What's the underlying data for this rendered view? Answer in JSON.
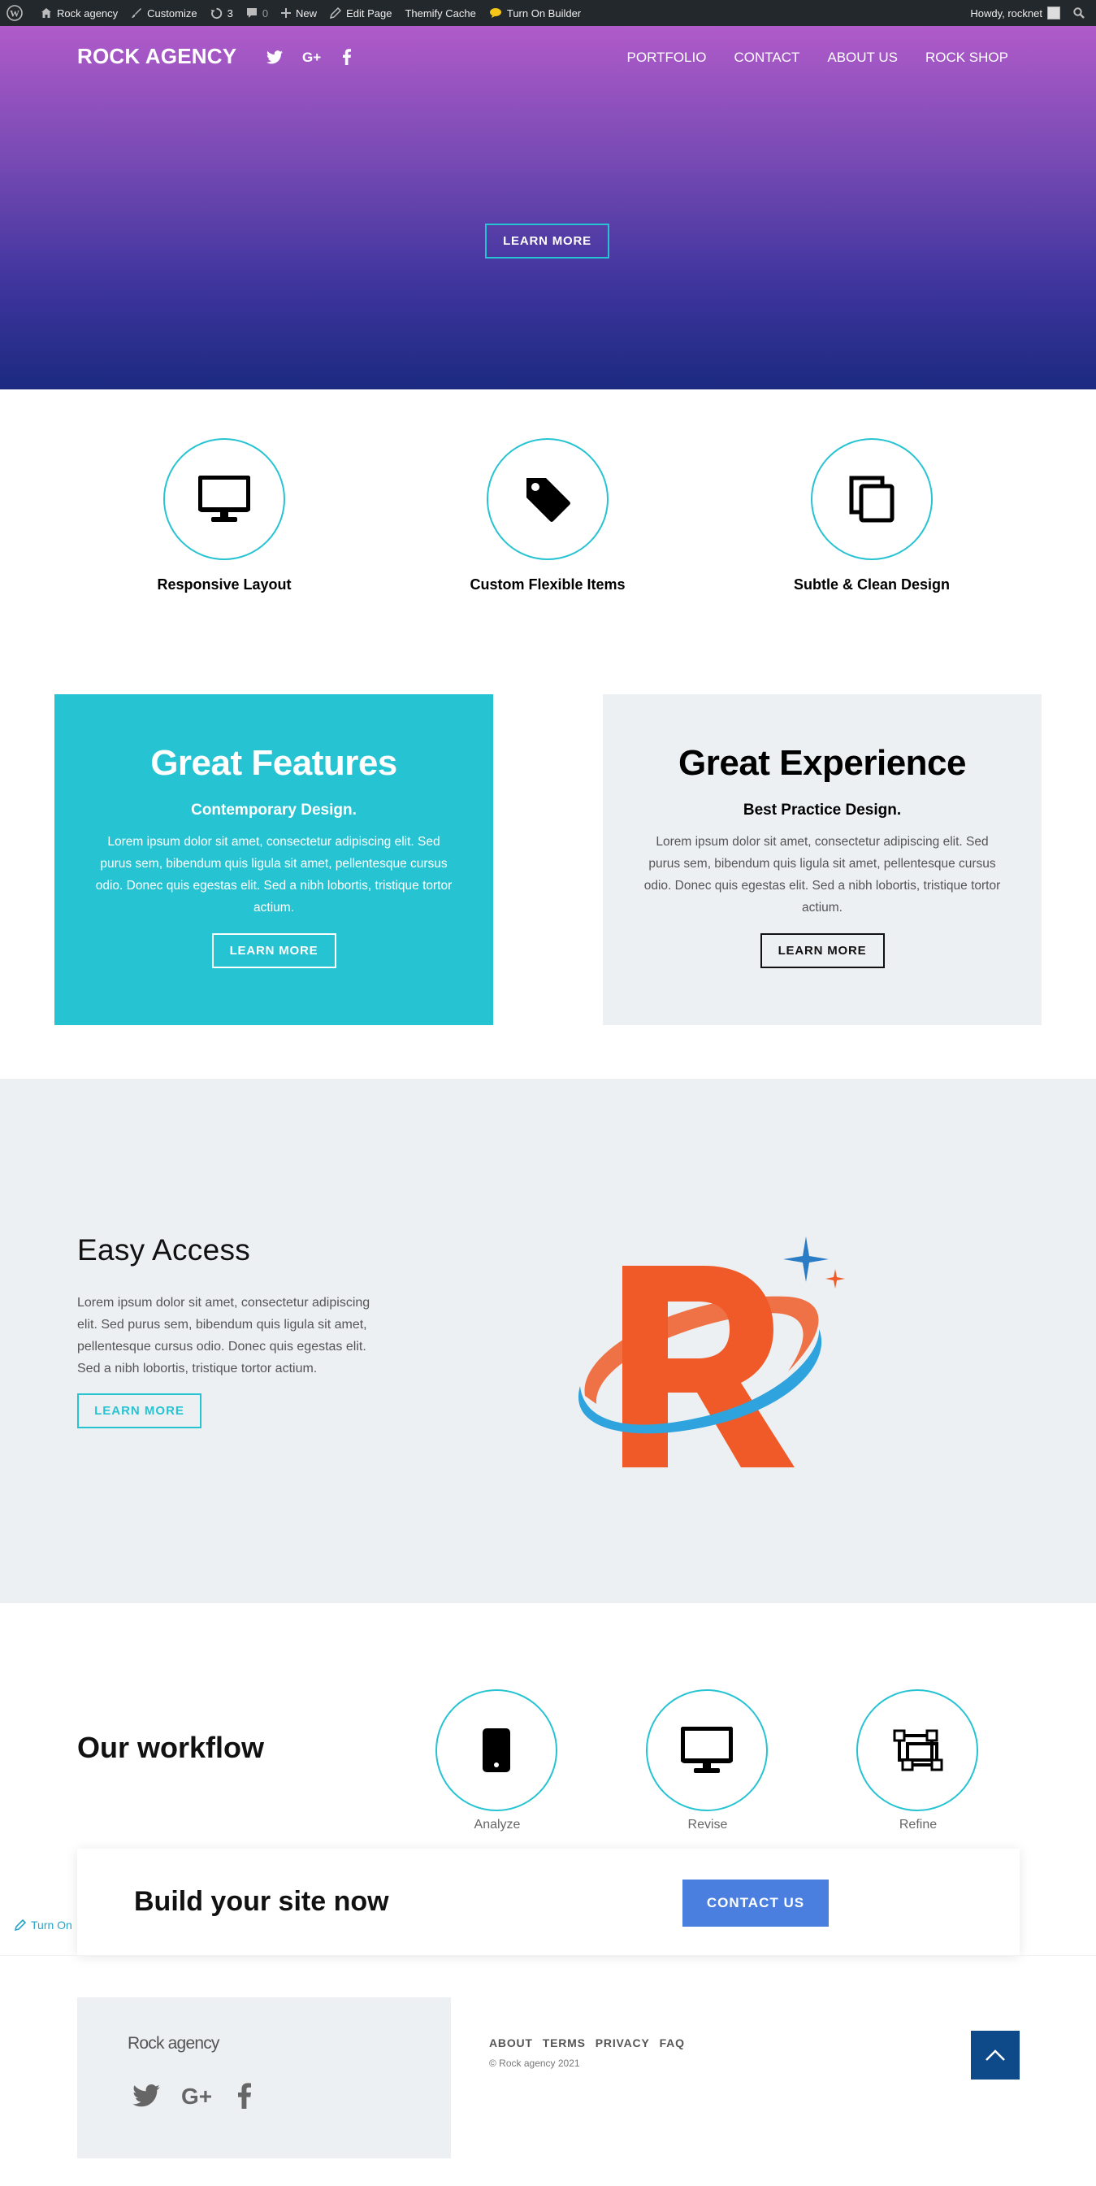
{
  "admin_bar": {
    "site": "Rock agency",
    "customize": "Customize",
    "updates": "3",
    "comments": "0",
    "new": "New",
    "edit_page": "Edit Page",
    "themify_cache": "Themify Cache",
    "builder": "Turn On Builder",
    "howdy": "Howdy, rocknet"
  },
  "hero": {
    "brand": "ROCK AGENCY",
    "social_icons": [
      "twitter-icon",
      "google-plus-icon",
      "facebook-icon"
    ],
    "nav": [
      "PORTFOLIO",
      "CONTACT",
      "ABOUT US",
      "ROCK SHOP"
    ],
    "button": "LEARN MORE"
  },
  "features": [
    {
      "icon": "monitor-icon",
      "title": "Responsive Layout"
    },
    {
      "icon": "tag-icon",
      "title": "Custom Flexible Items"
    },
    {
      "icon": "copy-icon",
      "title": "Subtle & Clean Design"
    }
  ],
  "cards": [
    {
      "title": "Great Features",
      "subtitle": "Contemporary Design.",
      "text": "Lorem ipsum dolor sit amet, consectetur adipiscing elit. Sed purus sem, bibendum quis ligula sit amet, pellentesque cursus odio. Donec quis egestas elit. Sed a nibh lobortis, tristique tortor actium.",
      "button": "LEARN MORE"
    },
    {
      "title": "Great Experience",
      "subtitle": "Best Practice Design.",
      "text": "Lorem ipsum dolor sit amet, consectetur adipiscing elit. Sed purus sem, bibendum quis ligula sit amet, pellentesque cursus odio. Donec quis egestas elit. Sed a nibh lobortis, tristique tortor actium.",
      "button": "LEARN MORE"
    }
  ],
  "access": {
    "title": "Easy Access",
    "text": "Lorem ipsum dolor sit amet, consectetur adipiscing elit. Sed purus sem, bibendum quis ligula sit amet, pellentesque cursus odio. Donec quis egestas elit. Sed a nibh lobortis, tristique tortor actium.",
    "button": "LEARN MORE"
  },
  "workflow": {
    "title": "Our workflow",
    "steps": [
      {
        "icon": "phone-icon",
        "label": "Analyze"
      },
      {
        "icon": "monitor-icon",
        "label": "Revise"
      },
      {
        "icon": "vector-icon",
        "label": "Refine"
      }
    ]
  },
  "cta": {
    "title": "Build your site now",
    "button": "CONTACT US"
  },
  "turn_on": "Turn On",
  "footer": {
    "brand": "Rock agency",
    "links": [
      "ABOUT",
      "TERMS",
      "PRIVACY",
      "FAQ"
    ],
    "copyright": "© Rock agency 2021"
  },
  "colors": {
    "accent": "#26c3d2",
    "cta": "#4a7fe0",
    "back_to_top": "#0e4a8a",
    "admin_bar": "#23282d"
  }
}
